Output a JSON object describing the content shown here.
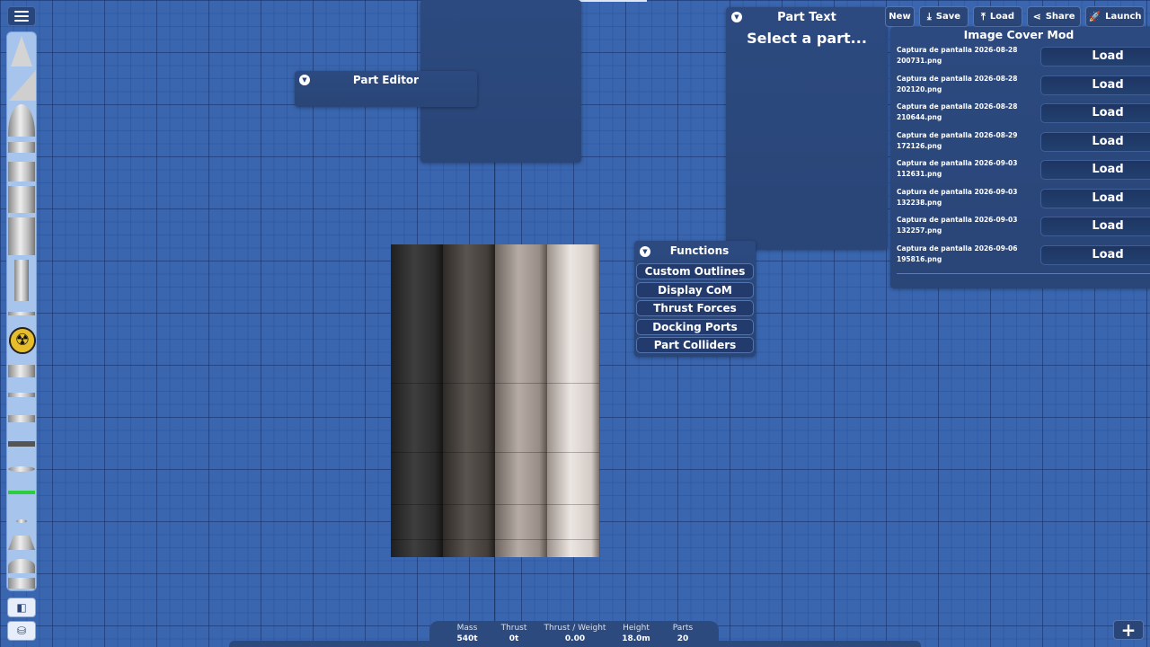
{
  "menu": {
    "icon": "hamburger-icon"
  },
  "part_editor": {
    "title": "Part Editor"
  },
  "part_text": {
    "title": "Part Text",
    "placeholder": "Select a part..."
  },
  "toolbar": {
    "new_label": "New",
    "save_label": "Save",
    "load_label": "Load",
    "share_label": "Share",
    "launch_label": "Launch"
  },
  "image_cover": {
    "title": "Image Cover Mod",
    "files": [
      {
        "name": "Captura de pantalla 2026-08-28 200731.png",
        "button": "Load"
      },
      {
        "name": "Captura de pantalla 2026-08-28 202120.png",
        "button": "Load"
      },
      {
        "name": "Captura de pantalla 2026-08-28 210644.png",
        "button": "Load"
      },
      {
        "name": "Captura de pantalla 2026-08-29 172126.png",
        "button": "Load"
      },
      {
        "name": "Captura de pantalla 2026-09-03 112631.png",
        "button": "Load"
      },
      {
        "name": "Captura de pantalla 2026-09-03 132238.png",
        "button": "Load"
      },
      {
        "name": "Captura de pantalla 2026-09-03 132257.png",
        "button": "Load"
      },
      {
        "name": "Captura de pantalla 2026-09-06 195816.png",
        "button": "Load"
      }
    ]
  },
  "functions": {
    "title": "Functions",
    "items": [
      "Custom Outlines",
      "Display CoM",
      "Thrust Forces",
      "Docking Ports",
      "Part Colliders"
    ]
  },
  "stats": {
    "mass_label": "Mass",
    "mass_value": "540t",
    "thrust_label": "Thrust",
    "thrust_value": "0t",
    "tw_label": "Thrust / Weight",
    "tw_value": "0.00",
    "height_label": "Height",
    "height_value": "18.0m",
    "parts_label": "Parts",
    "parts_value": "20"
  },
  "colors": {
    "background": "#3a66b0",
    "panel": "#2a4577",
    "parts_bar": "#a7c4ec"
  }
}
